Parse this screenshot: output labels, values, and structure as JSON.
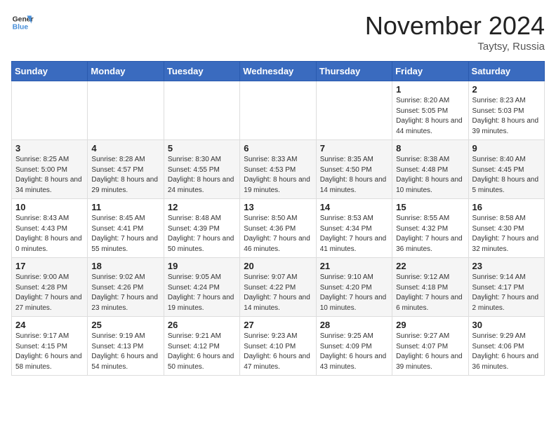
{
  "logo": {
    "line1": "General",
    "line2": "Blue"
  },
  "title": "November 2024",
  "location": "Taytsy, Russia",
  "days_of_week": [
    "Sunday",
    "Monday",
    "Tuesday",
    "Wednesday",
    "Thursday",
    "Friday",
    "Saturday"
  ],
  "weeks": [
    [
      {
        "day": "",
        "sunrise": "",
        "sunset": "",
        "daylight": ""
      },
      {
        "day": "",
        "sunrise": "",
        "sunset": "",
        "daylight": ""
      },
      {
        "day": "",
        "sunrise": "",
        "sunset": "",
        "daylight": ""
      },
      {
        "day": "",
        "sunrise": "",
        "sunset": "",
        "daylight": ""
      },
      {
        "day": "",
        "sunrise": "",
        "sunset": "",
        "daylight": ""
      },
      {
        "day": "1",
        "sunrise": "Sunrise: 8:20 AM",
        "sunset": "Sunset: 5:05 PM",
        "daylight": "Daylight: 8 hours and 44 minutes."
      },
      {
        "day": "2",
        "sunrise": "Sunrise: 8:23 AM",
        "sunset": "Sunset: 5:03 PM",
        "daylight": "Daylight: 8 hours and 39 minutes."
      }
    ],
    [
      {
        "day": "3",
        "sunrise": "Sunrise: 8:25 AM",
        "sunset": "Sunset: 5:00 PM",
        "daylight": "Daylight: 8 hours and 34 minutes."
      },
      {
        "day": "4",
        "sunrise": "Sunrise: 8:28 AM",
        "sunset": "Sunset: 4:57 PM",
        "daylight": "Daylight: 8 hours and 29 minutes."
      },
      {
        "day": "5",
        "sunrise": "Sunrise: 8:30 AM",
        "sunset": "Sunset: 4:55 PM",
        "daylight": "Daylight: 8 hours and 24 minutes."
      },
      {
        "day": "6",
        "sunrise": "Sunrise: 8:33 AM",
        "sunset": "Sunset: 4:53 PM",
        "daylight": "Daylight: 8 hours and 19 minutes."
      },
      {
        "day": "7",
        "sunrise": "Sunrise: 8:35 AM",
        "sunset": "Sunset: 4:50 PM",
        "daylight": "Daylight: 8 hours and 14 minutes."
      },
      {
        "day": "8",
        "sunrise": "Sunrise: 8:38 AM",
        "sunset": "Sunset: 4:48 PM",
        "daylight": "Daylight: 8 hours and 10 minutes."
      },
      {
        "day": "9",
        "sunrise": "Sunrise: 8:40 AM",
        "sunset": "Sunset: 4:45 PM",
        "daylight": "Daylight: 8 hours and 5 minutes."
      }
    ],
    [
      {
        "day": "10",
        "sunrise": "Sunrise: 8:43 AM",
        "sunset": "Sunset: 4:43 PM",
        "daylight": "Daylight: 8 hours and 0 minutes."
      },
      {
        "day": "11",
        "sunrise": "Sunrise: 8:45 AM",
        "sunset": "Sunset: 4:41 PM",
        "daylight": "Daylight: 7 hours and 55 minutes."
      },
      {
        "day": "12",
        "sunrise": "Sunrise: 8:48 AM",
        "sunset": "Sunset: 4:39 PM",
        "daylight": "Daylight: 7 hours and 50 minutes."
      },
      {
        "day": "13",
        "sunrise": "Sunrise: 8:50 AM",
        "sunset": "Sunset: 4:36 PM",
        "daylight": "Daylight: 7 hours and 46 minutes."
      },
      {
        "day": "14",
        "sunrise": "Sunrise: 8:53 AM",
        "sunset": "Sunset: 4:34 PM",
        "daylight": "Daylight: 7 hours and 41 minutes."
      },
      {
        "day": "15",
        "sunrise": "Sunrise: 8:55 AM",
        "sunset": "Sunset: 4:32 PM",
        "daylight": "Daylight: 7 hours and 36 minutes."
      },
      {
        "day": "16",
        "sunrise": "Sunrise: 8:58 AM",
        "sunset": "Sunset: 4:30 PM",
        "daylight": "Daylight: 7 hours and 32 minutes."
      }
    ],
    [
      {
        "day": "17",
        "sunrise": "Sunrise: 9:00 AM",
        "sunset": "Sunset: 4:28 PM",
        "daylight": "Daylight: 7 hours and 27 minutes."
      },
      {
        "day": "18",
        "sunrise": "Sunrise: 9:02 AM",
        "sunset": "Sunset: 4:26 PM",
        "daylight": "Daylight: 7 hours and 23 minutes."
      },
      {
        "day": "19",
        "sunrise": "Sunrise: 9:05 AM",
        "sunset": "Sunset: 4:24 PM",
        "daylight": "Daylight: 7 hours and 19 minutes."
      },
      {
        "day": "20",
        "sunrise": "Sunrise: 9:07 AM",
        "sunset": "Sunset: 4:22 PM",
        "daylight": "Daylight: 7 hours and 14 minutes."
      },
      {
        "day": "21",
        "sunrise": "Sunrise: 9:10 AM",
        "sunset": "Sunset: 4:20 PM",
        "daylight": "Daylight: 7 hours and 10 minutes."
      },
      {
        "day": "22",
        "sunrise": "Sunrise: 9:12 AM",
        "sunset": "Sunset: 4:18 PM",
        "daylight": "Daylight: 7 hours and 6 minutes."
      },
      {
        "day": "23",
        "sunrise": "Sunrise: 9:14 AM",
        "sunset": "Sunset: 4:17 PM",
        "daylight": "Daylight: 7 hours and 2 minutes."
      }
    ],
    [
      {
        "day": "24",
        "sunrise": "Sunrise: 9:17 AM",
        "sunset": "Sunset: 4:15 PM",
        "daylight": "Daylight: 6 hours and 58 minutes."
      },
      {
        "day": "25",
        "sunrise": "Sunrise: 9:19 AM",
        "sunset": "Sunset: 4:13 PM",
        "daylight": "Daylight: 6 hours and 54 minutes."
      },
      {
        "day": "26",
        "sunrise": "Sunrise: 9:21 AM",
        "sunset": "Sunset: 4:12 PM",
        "daylight": "Daylight: 6 hours and 50 minutes."
      },
      {
        "day": "27",
        "sunrise": "Sunrise: 9:23 AM",
        "sunset": "Sunset: 4:10 PM",
        "daylight": "Daylight: 6 hours and 47 minutes."
      },
      {
        "day": "28",
        "sunrise": "Sunrise: 9:25 AM",
        "sunset": "Sunset: 4:09 PM",
        "daylight": "Daylight: 6 hours and 43 minutes."
      },
      {
        "day": "29",
        "sunrise": "Sunrise: 9:27 AM",
        "sunset": "Sunset: 4:07 PM",
        "daylight": "Daylight: 6 hours and 39 minutes."
      },
      {
        "day": "30",
        "sunrise": "Sunrise: 9:29 AM",
        "sunset": "Sunset: 4:06 PM",
        "daylight": "Daylight: 6 hours and 36 minutes."
      }
    ]
  ]
}
